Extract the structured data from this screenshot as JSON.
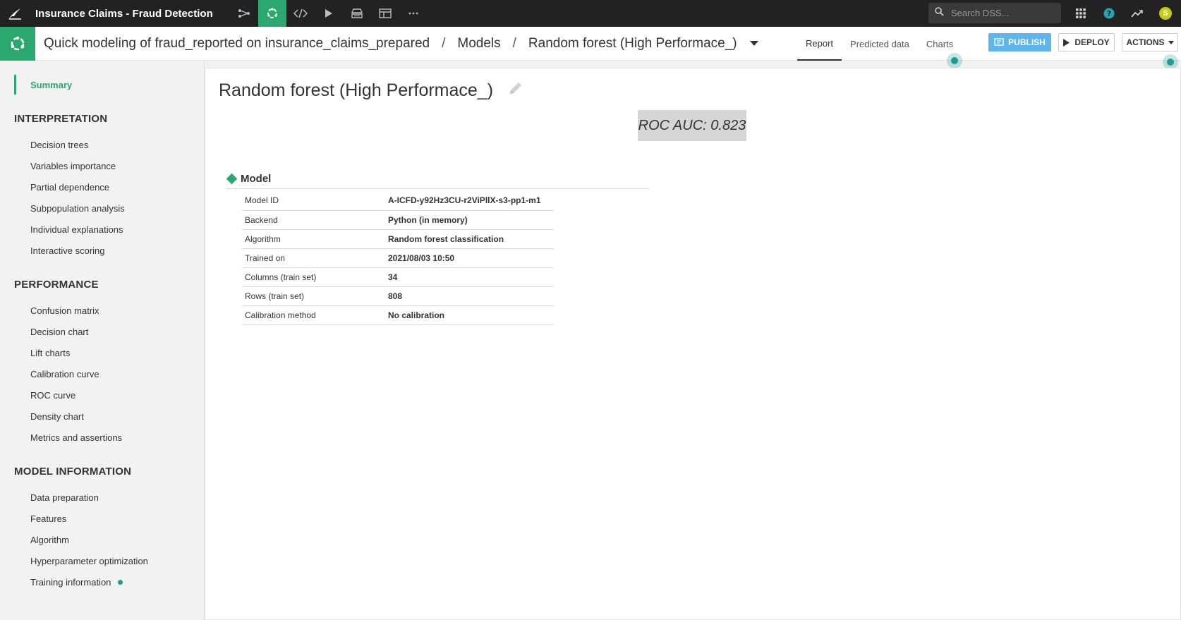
{
  "topbar": {
    "project_title": "Insurance Claims - Fraud Detection",
    "search_placeholder": "Search DSS...",
    "user_initial": "S"
  },
  "subheader": {
    "breadcrumb": {
      "analysis": "Quick modeling of fraud_reported on insurance_claims_prepared",
      "separator": "/",
      "models": "Models",
      "current": "Random forest (High Performace_)"
    },
    "tabs": [
      "Report",
      "Predicted data",
      "Charts"
    ],
    "active_tab": "Report",
    "publish_label": "PUBLISH",
    "deploy_label": "DEPLOY",
    "actions_label": "ACTIONS"
  },
  "sidebar": {
    "summary": "Summary",
    "sections": [
      {
        "heading": "INTERPRETATION",
        "items": [
          "Decision trees",
          "Variables importance",
          "Partial dependence",
          "Subpopulation analysis",
          "Individual explanations",
          "Interactive scoring"
        ]
      },
      {
        "heading": "PERFORMANCE",
        "items": [
          "Confusion matrix",
          "Decision chart",
          "Lift charts",
          "Calibration curve",
          "ROC curve",
          "Density chart",
          "Metrics and assertions"
        ]
      },
      {
        "heading": "MODEL INFORMATION",
        "items": [
          "Data preparation",
          "Features",
          "Algorithm",
          "Hyperparameter optimization",
          "Training information"
        ]
      }
    ]
  },
  "main": {
    "title": "Random forest (High Performace_)",
    "metric": "ROC AUC: 0.823",
    "section_title": "Model",
    "details": [
      {
        "key": "Model ID",
        "value": "A-ICFD-y92Hz3CU-r2ViPllX-s3-pp1-m1"
      },
      {
        "key": "Backend",
        "value": "Python (in memory)"
      },
      {
        "key": "Algorithm",
        "value": "Random forest classification"
      },
      {
        "key": "Trained on",
        "value": "2021/08/03 10:50"
      },
      {
        "key": "Columns (train set)",
        "value": "34"
      },
      {
        "key": "Rows (train set)",
        "value": "808"
      },
      {
        "key": "Calibration method",
        "value": "No calibration"
      }
    ]
  },
  "colors": {
    "accent_green": "#2aa86d",
    "topbar_bg": "#222222",
    "publish_blue": "#5db7ee",
    "hint_teal": "#1f9c96"
  }
}
